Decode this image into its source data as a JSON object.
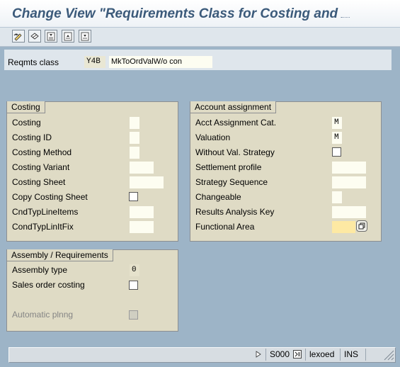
{
  "window": {
    "title": "Change View \"Requirements Class for Costing and Ac"
  },
  "toolbar": {
    "buttons": [
      {
        "icon": "display-change-icon"
      },
      {
        "icon": "other-entry-icon"
      },
      {
        "icon": "first-entry-icon"
      },
      {
        "icon": "previous-entry-icon"
      },
      {
        "icon": "next-entry-icon"
      }
    ]
  },
  "header": {
    "reqmts_class_label": "Reqmts class",
    "reqmts_class_value": "Y4B",
    "reqmts_class_desc": "MkToOrdValW/o con"
  },
  "costing": {
    "title": "Costing",
    "rows": [
      {
        "label": "Costing",
        "value": ""
      },
      {
        "label": "Costing ID",
        "value": ""
      },
      {
        "label": "Costing Method",
        "value": ""
      },
      {
        "label": "Costing Variant",
        "value": ""
      },
      {
        "label": "Costing Sheet",
        "value": ""
      },
      {
        "label": "Copy Costing Sheet",
        "checked": false
      },
      {
        "label": "CndTypLineItems",
        "value": ""
      },
      {
        "label": "CondTypLinItFix",
        "value": ""
      }
    ]
  },
  "account": {
    "title": "Account assignment",
    "rows": [
      {
        "label": "Acct Assignment Cat.",
        "value": "M"
      },
      {
        "label": "Valuation",
        "value": "M"
      },
      {
        "label": "Without Val. Strategy",
        "checked": false
      },
      {
        "label": "Settlement profile",
        "value": ""
      },
      {
        "label": "Strategy Sequence",
        "value": ""
      },
      {
        "label": "Changeable",
        "value": ""
      },
      {
        "label": "Results Analysis Key",
        "value": ""
      },
      {
        "label": "Functional Area",
        "value": ""
      }
    ]
  },
  "assembly": {
    "title": "Assembly / Requirements",
    "assembly_type_label": "Assembly type",
    "assembly_type_value": "0",
    "sales_order_costing_label": "Sales order costing",
    "sales_order_costing_checked": false,
    "automatic_planning_label": "Automatic plnng",
    "automatic_planning_checked": false
  },
  "status": {
    "system": "S000",
    "server": "lexoed",
    "mode": "INS"
  },
  "colors": {
    "background": "#9db4c7",
    "group_bg": "#dfdbc5",
    "input_bg": "#fdfdf1",
    "highlight_input": "#fde9a3",
    "title_text": "#3b5a7a"
  }
}
